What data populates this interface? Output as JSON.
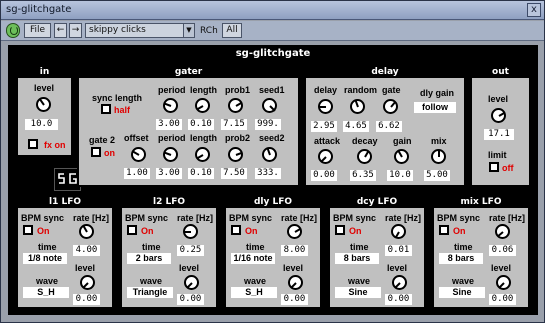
{
  "window": {
    "title": "sg-glitchgate",
    "close": "x"
  },
  "toolbar": {
    "file": "File",
    "prev": "←",
    "next": "→",
    "preset": "skippy clicks",
    "dropdown": "▼",
    "rch": "RCh",
    "all": "All"
  },
  "plugin": {
    "title": "sg-glitchgate"
  },
  "in": {
    "title": "in",
    "level_label": "level",
    "level_value": "10.0",
    "fxon_label": "fx on"
  },
  "gater": {
    "title": "gater",
    "sync_length_label": "sync length",
    "sync_length_state": "half",
    "row1": [
      {
        "label": "period",
        "value": "3.00"
      },
      {
        "label": "length",
        "value": "0.10"
      },
      {
        "label": "prob1",
        "value": "7.15"
      },
      {
        "label": "seed1",
        "value": "999."
      }
    ],
    "gate2_label": "gate 2",
    "gate2_state": "on",
    "row2": [
      {
        "label": "offset",
        "value": "1.00"
      },
      {
        "label": "period",
        "value": "3.00"
      },
      {
        "label": "length",
        "value": "0.10"
      },
      {
        "label": "prob2",
        "value": "7.50"
      },
      {
        "label": "seed2",
        "value": "333."
      }
    ]
  },
  "delay": {
    "title": "delay",
    "row1": [
      {
        "label": "delay",
        "value": "2.95"
      },
      {
        "label": "random",
        "value": "4.65"
      },
      {
        "label": "gate",
        "value": "6.62"
      }
    ],
    "dly_gain_label": "dly gain",
    "dly_gain_value": "follow",
    "row2": [
      {
        "label": "attack",
        "value": "0.00"
      },
      {
        "label": "decay",
        "value": "6.35"
      },
      {
        "label": "gain",
        "value": "10.0"
      },
      {
        "label": "mix",
        "value": "5.00"
      }
    ]
  },
  "out": {
    "title": "out",
    "level_label": "level",
    "level_value": "17.1",
    "limit_label": "limit",
    "limit_state": "off"
  },
  "lfos": [
    {
      "title": "l1 LFO",
      "bpm_label": "BPM sync",
      "on": "On",
      "rate_label": "rate [Hz]",
      "rate_value": "4.00",
      "time_label": "time",
      "time_value": "1/8 note",
      "level_label": "level",
      "wave_label": "wave",
      "wave_value": "S_H",
      "level_value": "0.00"
    },
    {
      "title": "l2 LFO",
      "bpm_label": "BPM sync",
      "on": "On",
      "rate_label": "rate [Hz]",
      "rate_value": "0.25",
      "time_label": "time",
      "time_value": "2 bars",
      "level_label": "level",
      "wave_label": "wave",
      "wave_value": "Triangle",
      "level_value": "0.00"
    },
    {
      "title": "dly LFO",
      "bpm_label": "BPM sync",
      "on": "On",
      "rate_label": "rate [Hz]",
      "rate_value": "8.00",
      "time_label": "time",
      "time_value": "1/16 note",
      "level_label": "level",
      "wave_label": "wave",
      "wave_value": "S_H",
      "level_value": "0.00"
    },
    {
      "title": "dcy LFO",
      "bpm_label": "BPM sync",
      "on": "On",
      "rate_label": "rate [Hz]",
      "rate_value": "0.01",
      "time_label": "time",
      "time_value": "8 bars",
      "level_label": "level",
      "wave_label": "wave",
      "wave_value": "Sine",
      "level_value": "0.00"
    },
    {
      "title": "mix LFO",
      "bpm_label": "BPM sync",
      "on": "On",
      "rate_label": "rate [Hz]",
      "rate_value": "0.06",
      "time_label": "time",
      "time_value": "8 bars",
      "level_label": "level",
      "wave_label": "wave",
      "wave_value": "Sine",
      "level_value": "0.00"
    }
  ],
  "colors": {
    "panel": "#c0c0c0",
    "frame": "#000000",
    "state_red": "#e00000",
    "power": "#6dbf5a"
  }
}
